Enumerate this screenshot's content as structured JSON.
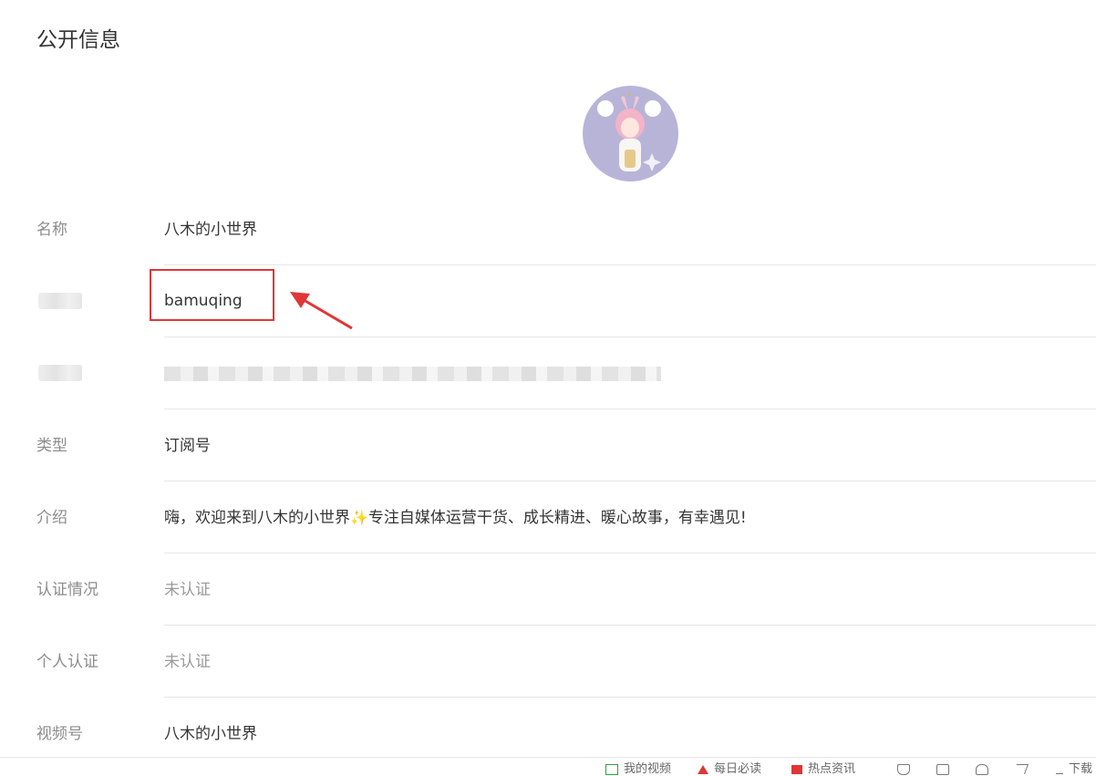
{
  "section_title": "公开信息",
  "rows": [
    {
      "label": "名称",
      "value": "八木的小世界"
    },
    {
      "label": "",
      "value": "bamuqing"
    },
    {
      "label": "",
      "value": ""
    },
    {
      "label": "类型",
      "value": "订阅号"
    },
    {
      "label": "介绍",
      "value_before": "嗨，欢迎来到八木的小世界",
      "value_after": "专注自媒体运营干货、成长精进、暖心故事，有幸遇见!"
    },
    {
      "label": "认证情况",
      "value": "未认证"
    },
    {
      "label": "个人认证",
      "value": "未认证"
    },
    {
      "label": "视频号",
      "value": "八木的小世界"
    }
  ],
  "intro_emoji_icon": "sparkle-icon",
  "highlight_color": "#e03636",
  "footer": {
    "items": [
      {
        "label": "我的视频",
        "icon": "video-icon",
        "color": "#2ea043"
      },
      {
        "label": "每日必读",
        "icon": "fire-icon",
        "color": "#e03636"
      },
      {
        "label": "热点资讯",
        "icon": "news-icon",
        "color": "#e03636"
      },
      {
        "label": "",
        "icon": "shield-icon"
      },
      {
        "label": "",
        "icon": "chat-icon"
      },
      {
        "label": "",
        "icon": "heart-icon"
      },
      {
        "label": "",
        "icon": "share-icon"
      },
      {
        "label": "下载",
        "icon": "download-icon"
      }
    ]
  }
}
